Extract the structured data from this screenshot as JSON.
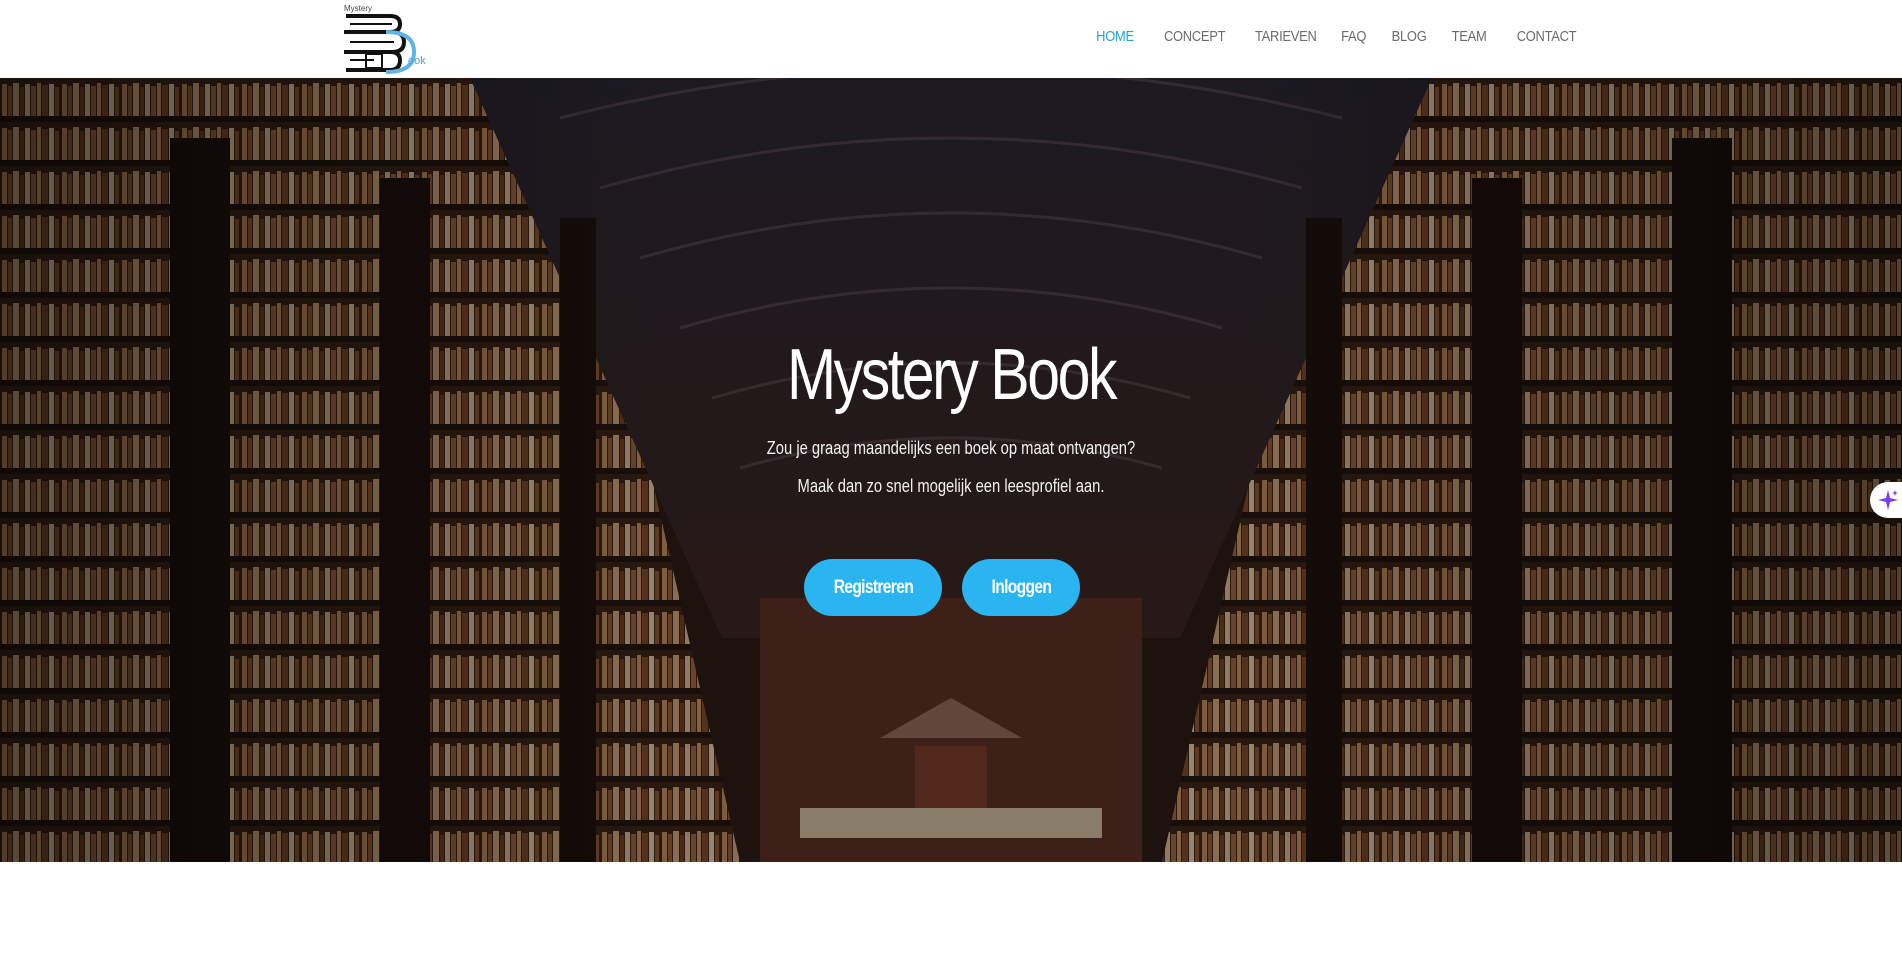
{
  "logo": {
    "small_text": "Mystery",
    "side_text": "ook"
  },
  "nav": {
    "items": [
      {
        "label": "HOME",
        "active": true
      },
      {
        "label": "CONCEPT",
        "active": false
      },
      {
        "label": "TARIEVEN",
        "active": false
      },
      {
        "label": "FAQ",
        "active": false
      },
      {
        "label": "BLOG",
        "active": false
      },
      {
        "label": "TEAM",
        "active": false
      },
      {
        "label": "CONTACT",
        "active": false
      }
    ]
  },
  "hero": {
    "title": "Mystery Book",
    "line1": "Zou je graag maandelijks een boek op maat ontvangen?",
    "line2": "Maak dan zo snel mogelijk een leesprofiel aan.",
    "register_label": "Registreren",
    "login_label": "Inloggen"
  },
  "colors": {
    "accent": "#2ab4f0",
    "nav_active": "#2a9fd6",
    "nav_text": "#6b6b6b"
  },
  "icons": {
    "side_widget": "sparkle-icon"
  }
}
